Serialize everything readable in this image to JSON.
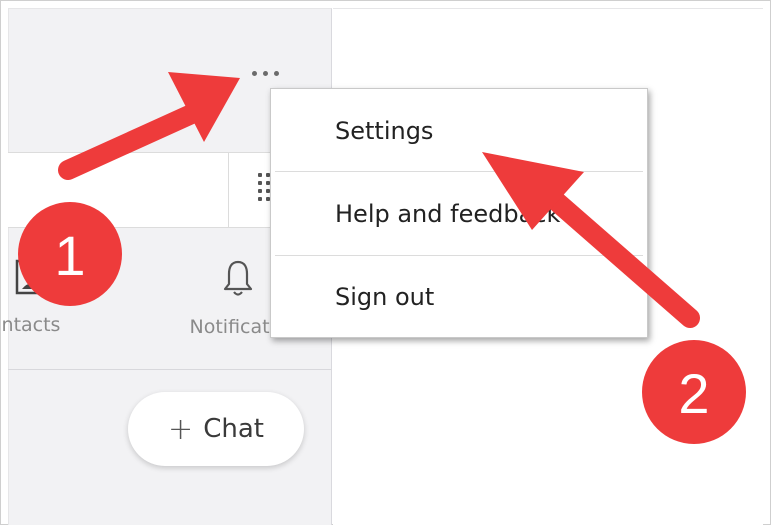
{
  "header": {
    "more_options_icon": "ellipsis-icon"
  },
  "search": {
    "value": "",
    "dialpad_icon": "dialpad-icon"
  },
  "nav": {
    "items": [
      {
        "label": "ntacts",
        "icon": "contacts-icon"
      },
      {
        "label": "Notificatio",
        "icon": "bell-icon"
      }
    ]
  },
  "chat_button": {
    "plus": "+",
    "label": "Chat"
  },
  "menu": {
    "items": [
      {
        "label": "Settings"
      },
      {
        "label": "Help and feedback"
      },
      {
        "label": "Sign out"
      }
    ]
  },
  "annotations": {
    "step1": "1",
    "step2": "2",
    "color": "#ee3b3b"
  }
}
